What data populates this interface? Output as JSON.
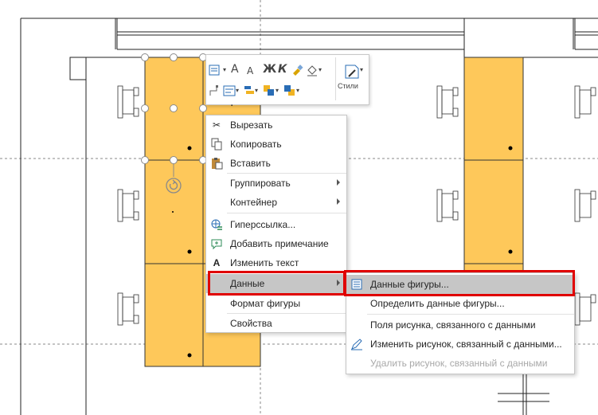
{
  "mini_toolbar": {
    "font_grow": "A",
    "font_shrink": "A",
    "bold": "Ж",
    "italic": "К",
    "styles_label": "Стили"
  },
  "context_menu": {
    "items": [
      {
        "label": "Вырезать",
        "icon": "scissors-icon"
      },
      {
        "label": "Копировать",
        "icon": "copy-icon"
      },
      {
        "label": "Вставить",
        "icon": "paste-icon"
      },
      {
        "label": "Группировать",
        "submenu": true
      },
      {
        "label": "Контейнер",
        "submenu": true
      },
      {
        "label": "Гиперссылка...",
        "icon": "hyperlink-icon"
      },
      {
        "label": "Добавить примечание",
        "icon": "comment-icon"
      },
      {
        "label": "Изменить текст",
        "icon": "text-icon",
        "icon_text": "A"
      },
      {
        "label": "Данные",
        "submenu": true,
        "highlighted": true
      },
      {
        "label": "Формат фигуры"
      },
      {
        "label": "Свойства"
      }
    ]
  },
  "submenu": {
    "items": [
      {
        "label": "Данные фигуры...",
        "icon": "shape-data-icon",
        "highlighted": true
      },
      {
        "label": "Определить данные фигуры..."
      },
      {
        "label": "Поля рисунка, связанного с данными"
      },
      {
        "label": "Изменить рисунок, связанный с данными...",
        "icon": "edit-graphic-icon"
      },
      {
        "label": "Удалить рисунок, связанный с данными",
        "disabled": true
      }
    ]
  },
  "colors": {
    "desk_fill": "#fec85a",
    "menu_highlight": "#c6c6c6",
    "annotation_red": "#e00000"
  }
}
